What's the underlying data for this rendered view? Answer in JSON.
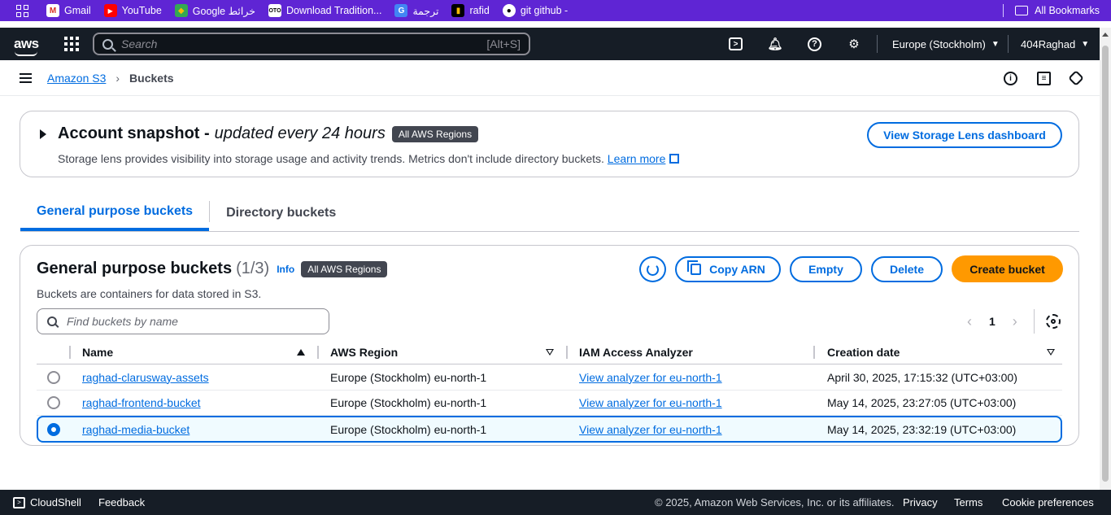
{
  "bookmarks": {
    "items": [
      {
        "label": "Gmail",
        "icon": "gmail-icon"
      },
      {
        "label": "YouTube",
        "icon": "youtube-icon"
      },
      {
        "label": "Google خرائط",
        "icon": "maps-icon"
      },
      {
        "label": "Download Tradition...",
        "icon": "oto-icon"
      },
      {
        "label": "ترجمة",
        "icon": "translate-icon"
      },
      {
        "label": "rafid",
        "icon": "rafid-icon"
      },
      {
        "label": "git github -",
        "icon": "github-icon"
      }
    ],
    "all_bookmarks": "All Bookmarks"
  },
  "topnav": {
    "search_placeholder": "Search",
    "search_shortcut": "[Alt+S]",
    "region": "Europe (Stockholm)",
    "user": "404Raghad"
  },
  "breadcrumb": {
    "parent": "Amazon S3",
    "current": "Buckets"
  },
  "snapshot": {
    "title": "Account snapshot - ",
    "title_em": "updated every 24 hours",
    "badge": "All AWS Regions",
    "description": "Storage lens provides visibility into storage usage and activity trends. Metrics don't include directory buckets.",
    "learn_more": "Learn more",
    "button": "View Storage Lens dashboard"
  },
  "tabs": [
    {
      "label": "General purpose buckets",
      "active": true
    },
    {
      "label": "Directory buckets",
      "active": false
    }
  ],
  "buckets": {
    "title": "General purpose buckets",
    "count": "(1/3)",
    "info": "Info",
    "badge": "All AWS Regions",
    "description": "Buckets are containers for data stored in S3.",
    "copy_arn": "Copy ARN",
    "empty": "Empty",
    "delete": "Delete",
    "create": "Create bucket",
    "filter_placeholder": "Find buckets by name",
    "page": "1",
    "columns": [
      "Name",
      "AWS Region",
      "IAM Access Analyzer",
      "Creation date"
    ],
    "rows": [
      {
        "name": "raghad-clarusway-assets",
        "region": "Europe (Stockholm) eu-north-1",
        "analyzer": "View analyzer for eu-north-1",
        "date": "April 30, 2025, 17:15:32 (UTC+03:00)",
        "selected": false
      },
      {
        "name": "raghad-frontend-bucket",
        "region": "Europe (Stockholm) eu-north-1",
        "analyzer": "View analyzer for eu-north-1",
        "date": "May 14, 2025, 23:27:05 (UTC+03:00)",
        "selected": false
      },
      {
        "name": "raghad-media-bucket",
        "region": "Europe (Stockholm) eu-north-1",
        "analyzer": "View analyzer for eu-north-1",
        "date": "May 14, 2025, 23:32:19 (UTC+03:00)",
        "selected": true
      }
    ]
  },
  "footer": {
    "cloudshell": "CloudShell",
    "feedback": "Feedback",
    "copyright": "© 2025, Amazon Web Services, Inc. or its affiliates.",
    "privacy": "Privacy",
    "terms": "Terms",
    "cookies": "Cookie preferences"
  },
  "colors": {
    "bookmarks_bar": "#5f25d4",
    "nav": "#161d26",
    "link": "#006ce0",
    "primary_button": "#ff9900"
  }
}
